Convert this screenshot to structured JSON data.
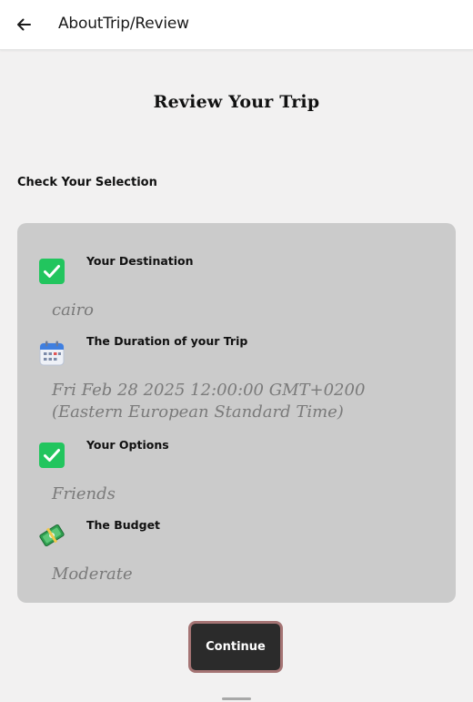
{
  "header": {
    "title": "AboutTrip/Review",
    "back_icon": "arrow-left-icon"
  },
  "page": {
    "title": "Review Your Trip",
    "section_label": "Check Your Selection"
  },
  "review_items": [
    {
      "title": "Your Destination",
      "value": "cairo",
      "icon": "check-box-icon"
    },
    {
      "title": "The Duration of your Trip",
      "value": "Fri Feb 28 2025 12:00:00 GMT+0200 (Eastern European Standard Time)",
      "icon": "calendar-icon"
    },
    {
      "title": "Your Options",
      "value": "Friends",
      "icon": "check-box-icon"
    },
    {
      "title": "The Budget",
      "value": "Moderate",
      "icon": "money-icon"
    }
  ],
  "actions": {
    "continue_label": "Continue"
  },
  "colors": {
    "background": "#f2f1f1",
    "card": "#cbcbcb",
    "check": "#22c55e",
    "button": "#2b2b2b",
    "button_border": "#a57474"
  }
}
